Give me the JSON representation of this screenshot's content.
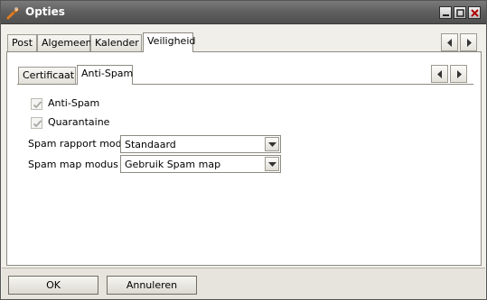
{
  "window": {
    "title": "Opties",
    "icon": "wrench-icon",
    "controls": [
      "minimize-icon",
      "maximize-icon",
      "close-icon"
    ]
  },
  "tabs": [
    {
      "label": "Post",
      "active": false
    },
    {
      "label": "Algemeen",
      "active": false
    },
    {
      "label": "Kalender",
      "active": false
    },
    {
      "label": "Veiligheid",
      "active": true
    }
  ],
  "subtabs": [
    {
      "label": "Certificaat",
      "active": false
    },
    {
      "label": "Anti-Spam",
      "active": true
    }
  ],
  "antispam": {
    "checkbox_antispam": {
      "label": "Anti-Spam",
      "checked": true,
      "disabled": true
    },
    "checkbox_quarantaine": {
      "label": "Quarantaine",
      "checked": true,
      "disabled": true
    },
    "report_mode": {
      "label": "Spam rapport modus",
      "value": "Standaard"
    },
    "map_mode": {
      "label": "Spam map modus",
      "value": "Gebruik Spam map"
    }
  },
  "buttons": {
    "ok": "OK",
    "cancel": "Annuleren"
  },
  "colors": {
    "titlebar": "#5e5e5e",
    "background": "#f0efea",
    "panel": "#ffffff"
  }
}
